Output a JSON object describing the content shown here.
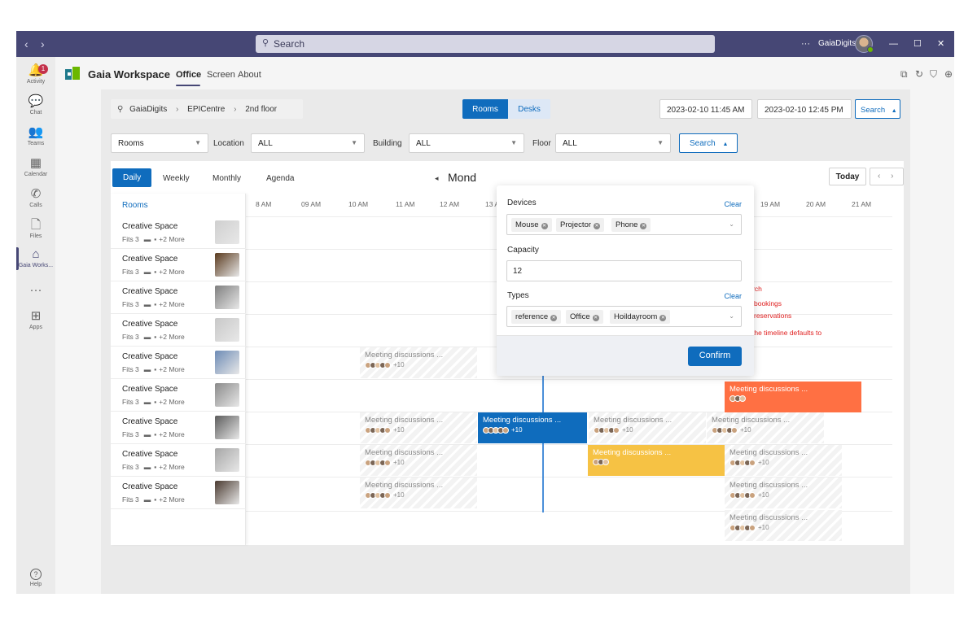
{
  "titlebar": {
    "back": "‹",
    "forward": "›",
    "search_placeholder": "Search",
    "more": "···",
    "user": "GaiaDigits",
    "minimize": "—",
    "maximize": "☐",
    "close": "✕"
  },
  "rail": {
    "badge": "1",
    "items": [
      {
        "label": "Activity",
        "icon": "bell-icon",
        "glyph": "🔔"
      },
      {
        "label": "Chat",
        "icon": "chat-icon",
        "glyph": "💬"
      },
      {
        "label": "Teams",
        "icon": "teams-icon",
        "glyph": "👥"
      },
      {
        "label": "Calendar",
        "icon": "calendar-icon",
        "glyph": "▦"
      },
      {
        "label": "Calls",
        "icon": "phone-icon",
        "glyph": "✆"
      },
      {
        "label": "Files",
        "icon": "file-icon",
        "glyph": "🗋"
      },
      {
        "label": "Gaia Works...",
        "icon": "gaia-app-icon",
        "glyph": "⌂"
      },
      {
        "label": "",
        "icon": "more-apps-icon",
        "glyph": "···"
      },
      {
        "label": "Apps",
        "icon": "apps-icon",
        "glyph": "⊞"
      },
      {
        "label": "Help",
        "icon": "help-icon",
        "glyph": "?"
      }
    ]
  },
  "app": {
    "name": "Gaia Workspace",
    "tabs": [
      "Office",
      "Screen",
      "About"
    ],
    "active_tab": "Office"
  },
  "breadcrumb": {
    "items": [
      "GaiaDigits",
      "EPICentre",
      "2nd floor"
    ],
    "sep": "›"
  },
  "mode_toggle": {
    "rooms": "Rooms",
    "desks": "Desks",
    "active": "Rooms"
  },
  "datetime": {
    "start": "2023-02-10 11:45 AM",
    "end": "2023-02-10 12:45 PM",
    "search": "Search"
  },
  "filters": {
    "type_value": "Rooms",
    "location_label": "Location",
    "location_value": "ALL",
    "building_label": "Building",
    "building_value": "ALL",
    "floor_label": "Floor",
    "floor_value": "ALL",
    "search": "Search"
  },
  "calendar": {
    "views": [
      "Daily",
      "Weekly",
      "Monthly",
      "Agenda"
    ],
    "active_view": "Daily",
    "date_label": "Mond",
    "prev": "◂",
    "today": "Today",
    "nav_prev": "‹",
    "nav_next": "›",
    "rooms_header": "Rooms",
    "hours": [
      "8 AM",
      "09 AM",
      "10 AM",
      "11 AM",
      "12 AM",
      "13 A",
      "19 AM",
      "20 AM",
      "21 AM"
    ]
  },
  "rooms": [
    {
      "name": "Creative Space",
      "fits": "Fits 3",
      "more": "+2 More",
      "color": "#cfcfcf"
    },
    {
      "name": "Creative Space",
      "fits": "Fits 3",
      "more": "+2 More",
      "color": "#5a3a1e"
    },
    {
      "name": "Creative Space",
      "fits": "Fits 3",
      "more": "+2 More",
      "color": "#7f7f7f"
    },
    {
      "name": "Creative Space",
      "fits": "Fits 3",
      "more": "+2 More",
      "color": "#c8c8c8"
    },
    {
      "name": "Creative Space",
      "fits": "Fits 3",
      "more": "+2 More",
      "color": "#6d8bb5"
    },
    {
      "name": "Creative Space",
      "fits": "Fits 3",
      "more": "+2 More",
      "color": "#8a8a8a"
    },
    {
      "name": "Creative Space",
      "fits": "Fits 3",
      "more": "+2 More",
      "color": "#5c5c5c"
    },
    {
      "name": "Creative Space",
      "fits": "Fits 3",
      "more": "+2 More",
      "color": "#a6a6a6"
    },
    {
      "name": "Creative Space",
      "fits": "Fits 3",
      "more": "+2 More",
      "color": "#4a3a30"
    }
  ],
  "events": {
    "title": "Meeting discussions ...",
    "more": "+10"
  },
  "notes": [
    "rch",
    "bookings",
    "reservations",
    "the timeline defaults to"
  ],
  "popup": {
    "devices_label": "Devices",
    "devices": [
      "Mouse",
      "Projector",
      "Phone"
    ],
    "capacity_label": "Capacity",
    "capacity_value": "12",
    "types_label": "Types",
    "types": [
      "reference",
      "Office",
      "Hoildayroom"
    ],
    "clear": "Clear",
    "confirm": "Confirm"
  },
  "colors": {
    "brand": "#464775",
    "primary": "#0f6cbd",
    "orange": "#ff7043",
    "yellow": "#f6c244",
    "badge": "#c4314b"
  }
}
